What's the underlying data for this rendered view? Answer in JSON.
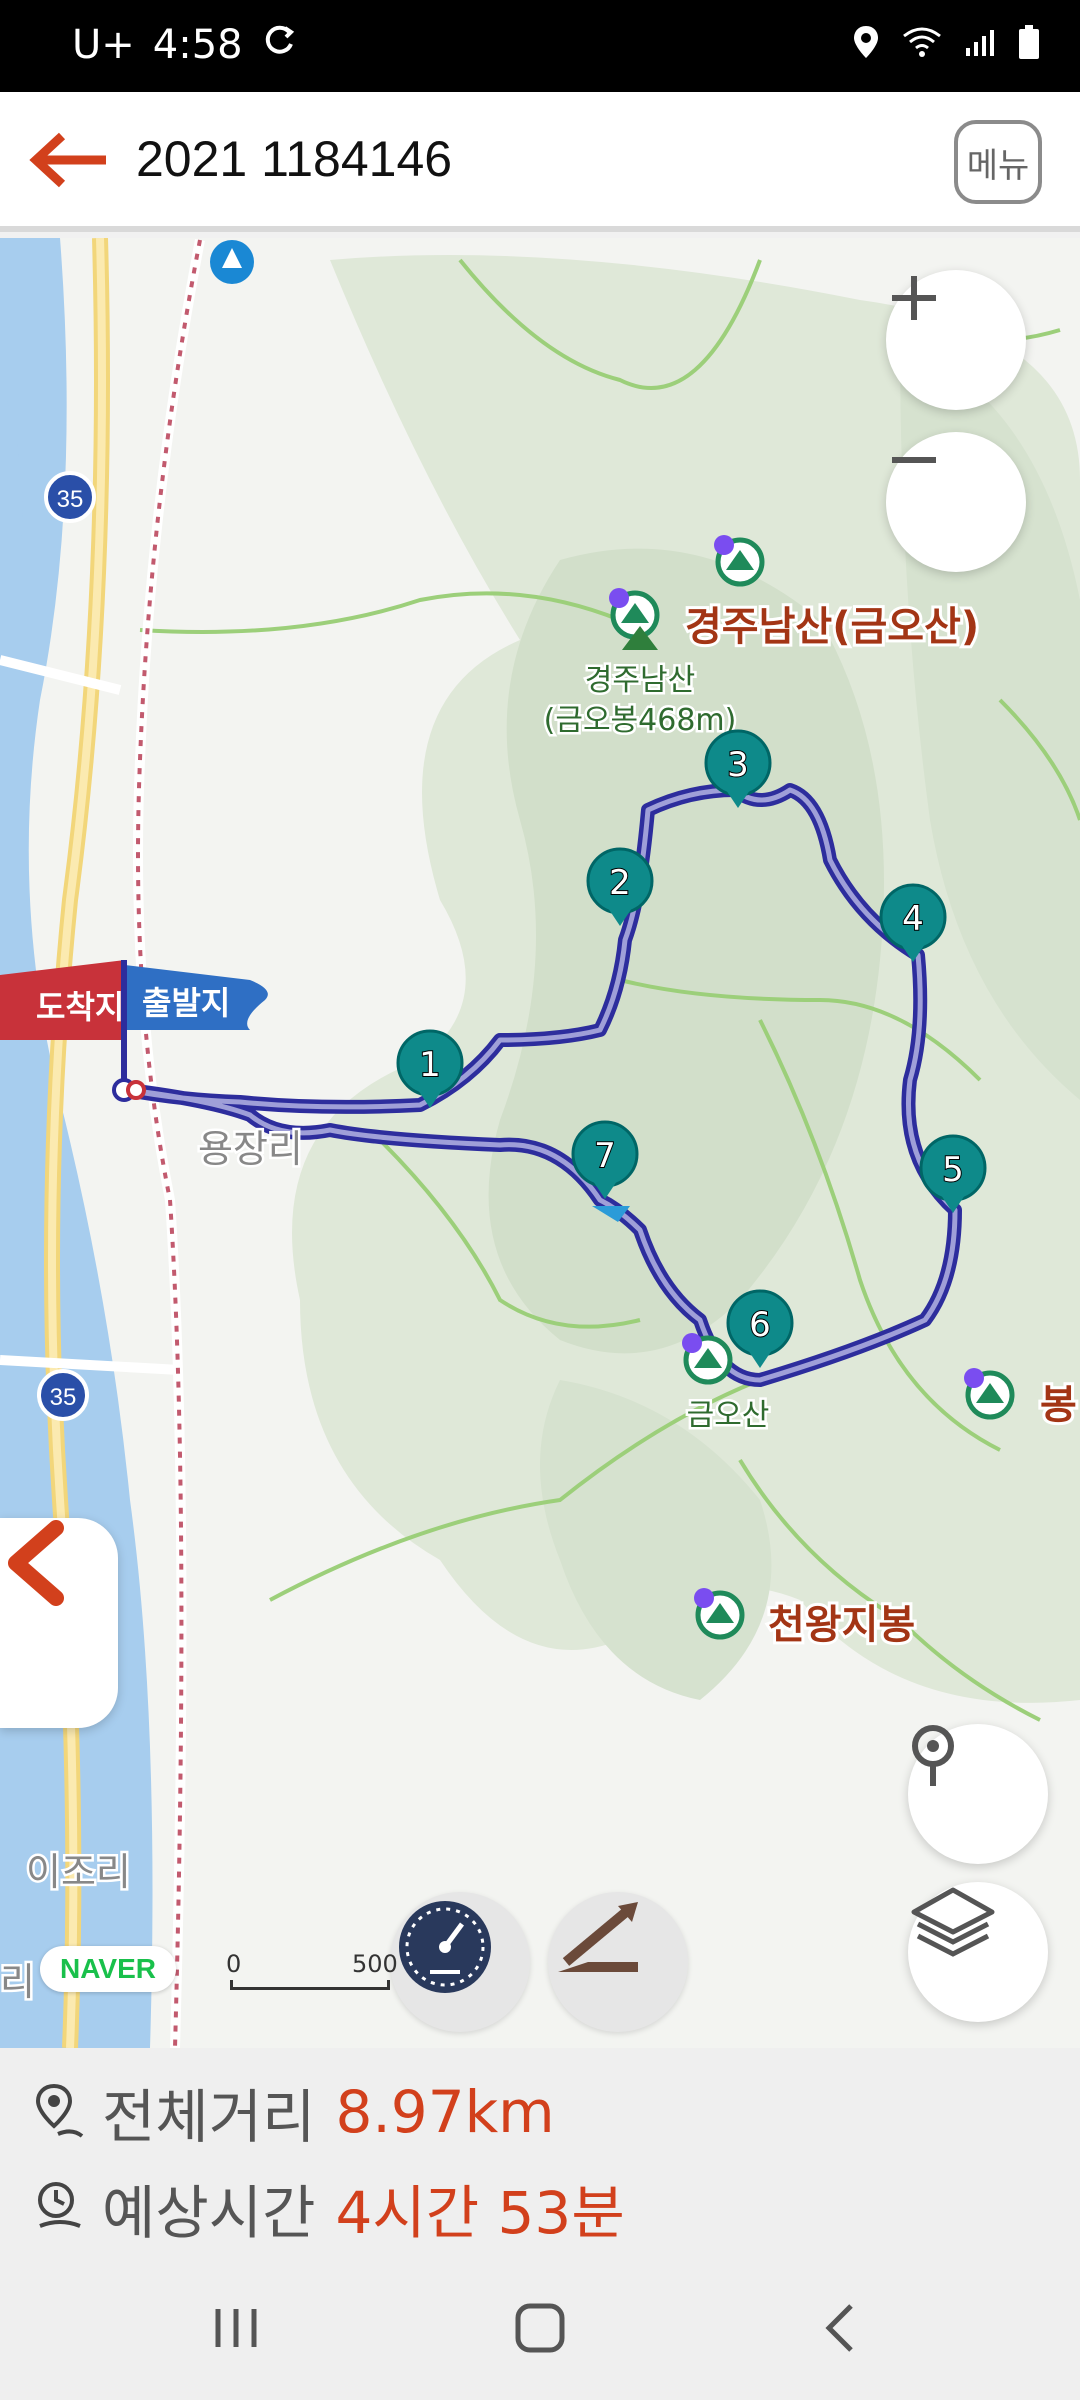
{
  "status": {
    "carrier": "U+",
    "time": "4:58"
  },
  "header": {
    "title": "2021 1184146",
    "menu_label": "메뉴"
  },
  "map": {
    "place_labels": {
      "gyeongju_namsan": "경주남산(금오산)",
      "peak_name": "경주남산",
      "peak_height": "(금오봉468m)",
      "yongjangri": "용장리",
      "geumosan": "금오산",
      "cheonwang": "천왕지봉",
      "bong": "봉",
      "ijori": "이조리",
      "ri": "리"
    },
    "road_numbers": [
      "35",
      "35"
    ],
    "flags": {
      "finish": "도착지",
      "start": "출발지"
    },
    "waypoints": [
      "1",
      "2",
      "3",
      "4",
      "5",
      "6",
      "7"
    ],
    "scale": {
      "start": "0",
      "end": "500"
    },
    "attribution": "NAVER"
  },
  "controls": {
    "zoom_in": "plus-icon",
    "zoom_out": "minus-icon",
    "location": "location-pin-icon",
    "layers": "layers-icon",
    "speed": "speedometer-icon",
    "elevation": "elevation-graph-icon",
    "collapse": "chevron-left-icon"
  },
  "summary": {
    "distance_label": "전체거리",
    "distance_value": "8.97km",
    "time_label": "예상시간",
    "time_value": "4시간 53분"
  },
  "colors": {
    "accent": "#d2401c",
    "route": "#2c2c9e",
    "marker": "#0e8a8a"
  }
}
